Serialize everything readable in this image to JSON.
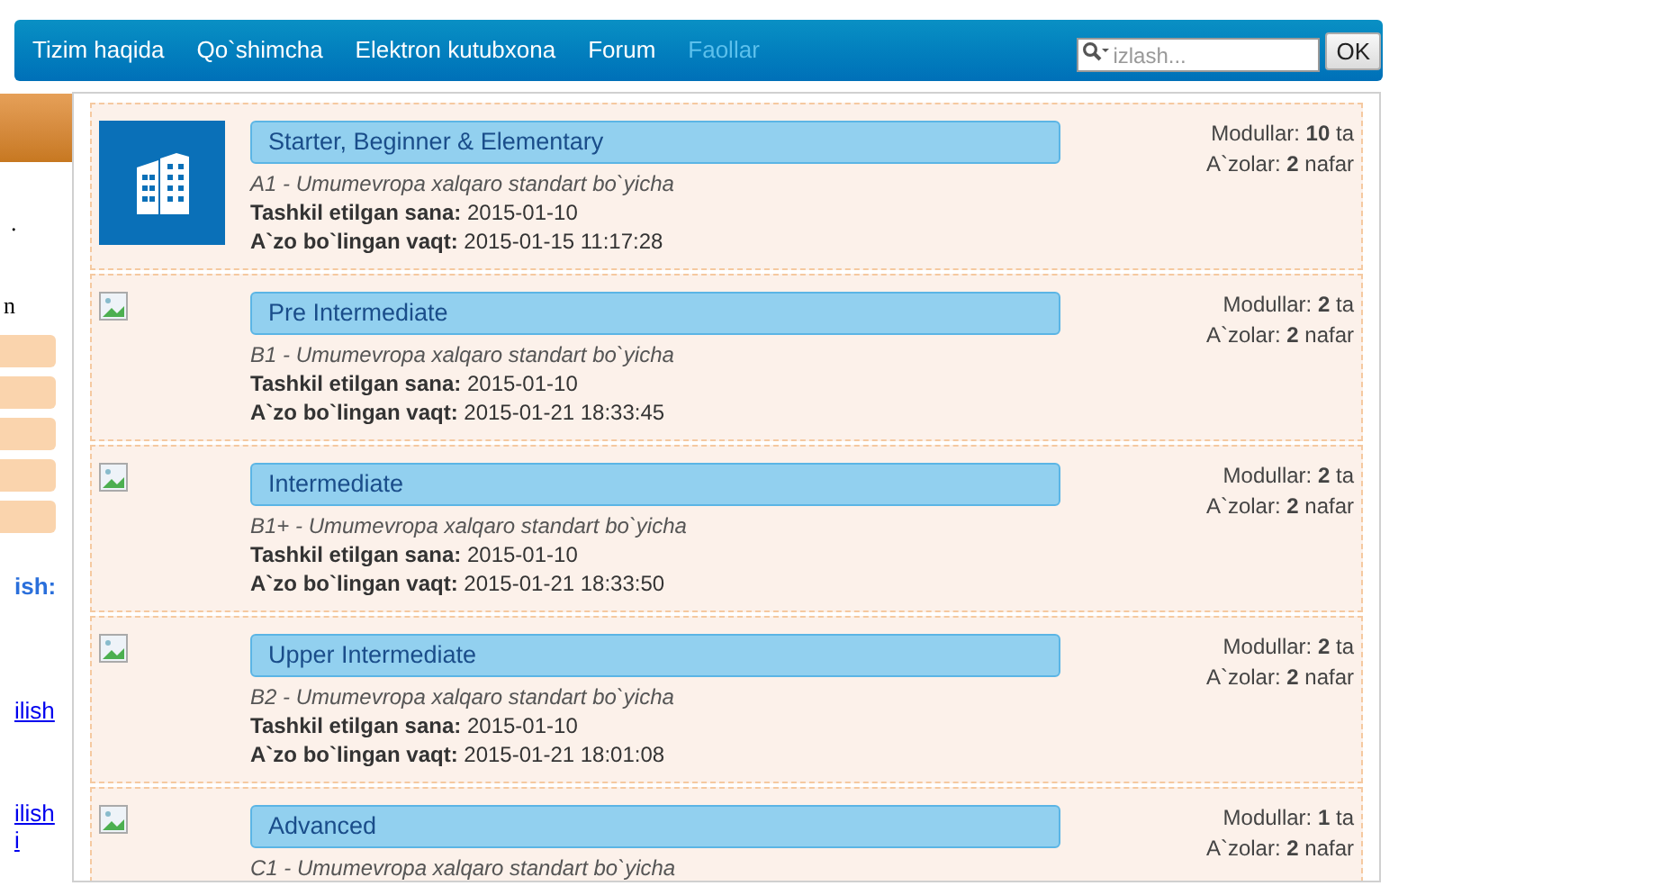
{
  "nav": {
    "items": [
      {
        "label": "Tizim haqida",
        "disabled": false
      },
      {
        "label": "Qo`shimcha",
        "disabled": false
      },
      {
        "label": "Elektron kutubxona",
        "disabled": false
      },
      {
        "label": "Forum",
        "disabled": false
      },
      {
        "label": "Faollar",
        "disabled": true
      }
    ],
    "search": {
      "placeholder": "izlash..."
    },
    "search_button": "OK"
  },
  "sidebar": {
    "texts": [
      ".",
      "n"
    ],
    "links": [
      {
        "kind": "heading",
        "text": "ish:"
      },
      {
        "kind": "link",
        "text": "ilish"
      },
      {
        "kind": "link",
        "text": "ilish"
      },
      {
        "kind": "link",
        "text": "i"
      }
    ]
  },
  "groups": [
    {
      "kind": "logo",
      "title": "Starter, Beginner & Elementary",
      "standard": "A1 - Umumevropa xalqaro standart bo`yicha",
      "created_label": "Tashkil etilgan sana:",
      "created": "2015-01-10",
      "joined_label": "A`zo bo`lingan vaqt:",
      "joined": "2015-01-15 11:17:28",
      "modules": "Modullar: **10** ta",
      "members": "A`zolar: **2** nafar"
    },
    {
      "kind": "broken",
      "title": "Pre Intermediate",
      "standard": "B1 - Umumevropa xalqaro standart bo`yicha",
      "created_label": "Tashkil etilgan sana:",
      "created": "2015-01-10",
      "joined_label": "A`zo bo`lingan vaqt:",
      "joined": "2015-01-21 18:33:45",
      "modules": "Modullar: **2** ta",
      "members": "A`zolar: **2** nafar"
    },
    {
      "kind": "broken",
      "title": "Intermediate",
      "standard": "B1+ - Umumevropa xalqaro standart bo`yicha",
      "created_label": "Tashkil etilgan sana:",
      "created": "2015-01-10",
      "joined_label": "A`zo bo`lingan vaqt:",
      "joined": "2015-01-21 18:33:50",
      "modules": "Modullar: **2** ta",
      "members": "A`zolar: **2** nafar"
    },
    {
      "kind": "broken",
      "title": "Upper Intermediate",
      "standard": "B2 - Umumevropa xalqaro standart bo`yicha",
      "created_label": "Tashkil etilgan sana:",
      "created": "2015-01-10",
      "joined_label": "A`zo bo`lingan vaqt:",
      "joined": "2015-01-21 18:01:08",
      "modules": "Modullar: **2** ta",
      "members": "A`zolar: **2** nafar"
    },
    {
      "kind": "broken",
      "title": "Advanced",
      "standard": "C1 - Umumevropa xalqaro standart bo`yicha",
      "modules": "Modullar: **1** ta",
      "members": "A`zolar: **2** nafar"
    }
  ]
}
